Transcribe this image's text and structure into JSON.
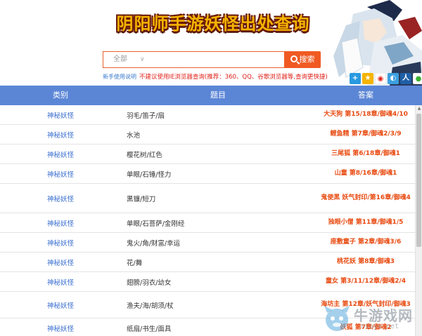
{
  "header": {
    "title": "阴阳师手游妖怪出处查询",
    "search": {
      "selected": "全部",
      "button_label": "搜索"
    },
    "help_link": "新手使用说明",
    "notice": "不建议使用IE浏览器查询(推荐：360、QQ、谷歌浏览器等,查询更快捷)",
    "share_icons": [
      "plus-share-icon",
      "qzone-share-icon",
      "weibo-share-icon",
      "tencent-weibo-share-icon",
      "renren-share-icon",
      "wechat-share-icon"
    ]
  },
  "table": {
    "columns": [
      "类别",
      "题目",
      "答案"
    ],
    "rows": [
      {
        "category": "神秘妖怪",
        "question": "羽毛/笛子/扇",
        "answer": "大天狗 第15/18章/御魂4/10"
      },
      {
        "category": "神秘妖怪",
        "question": "水池",
        "answer": "鲤鱼精 第7章/御魂2/3/9"
      },
      {
        "category": "神秘妖怪",
        "question": "樱花树/红色",
        "answer": "三尾狐 第6/18章/御魂1"
      },
      {
        "category": "神秘妖怪",
        "question": "单眼/石锤/怪力",
        "answer": "山童 第8/16章/御魂1"
      },
      {
        "category": "神秘妖怪",
        "question": "黑镰/短刀",
        "answer": "鬼使黑 妖气封印/第16章/御魂4"
      },
      {
        "category": "神秘妖怪",
        "question": "单眼/石菩萨/金刚经",
        "answer": "独眼小僧 第11章/御魂1/5"
      },
      {
        "category": "神秘妖怪",
        "question": "鬼火/角/财富/幸运",
        "answer": "座敷童子 第2章/御魂3/6"
      },
      {
        "category": "神秘妖怪",
        "question": "花/舞",
        "answer": "桃花妖 第8章/御魂3"
      },
      {
        "category": "神秘妖怪",
        "question": "翅膀/羽衣/幼女",
        "answer": "童女 第3/11/12章/御魂2/4"
      },
      {
        "category": "神秘妖怪",
        "question": "渔夫/海/胡须/杖",
        "answer": "海坊主 第12章/妖气封印/御魂3"
      },
      {
        "category": "神秘妖怪",
        "question": "纸扇/书生/面具",
        "answer": "妖狐 第7章/御魂2"
      }
    ]
  },
  "watermark": {
    "name": "牛游戏网",
    "url": "niuyx.net"
  },
  "colors": {
    "header_bar": "#5b86d6",
    "accent": "#f05a22",
    "answer": "#e84a10",
    "link": "#3a6fd0"
  }
}
